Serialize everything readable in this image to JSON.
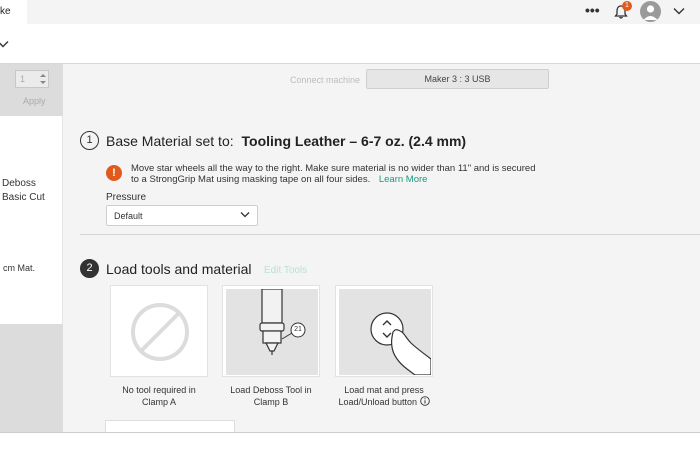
{
  "topbar": {
    "tab_label": "ke",
    "more_label": "•••",
    "notification_count": "1"
  },
  "sidebar": {
    "quantity_value": "1",
    "apply_label": "Apply",
    "items": [
      {
        "label": "Deboss"
      },
      {
        "label": "Basic Cut"
      },
      {
        "label": "cm Mat."
      }
    ]
  },
  "machine": {
    "connect_label": "Connect machine",
    "selected_machine": "Maker 3 : 3 USB"
  },
  "step1": {
    "number": "1",
    "title_prefix": "Base Material set to:",
    "material": "Tooling Leather – 6-7 oz. (2.4 mm)",
    "warning_icon": "!",
    "warning_text": "Move star wheels all the way to the right. Make sure material is no wider than 11\" and is secured to a StrongGrip Mat using masking tape on all four sides.",
    "learn_more_label": "Learn More",
    "pressure_label": "Pressure",
    "pressure_value": "Default"
  },
  "step2": {
    "number": "2",
    "title": "Load tools and material",
    "edit_tools_label": "Edit Tools",
    "cards": [
      {
        "label": "No tool required in Clamp A",
        "icon": "no-tool-icon"
      },
      {
        "label": "Load Deboss Tool in Clamp B",
        "icon": "deboss-tool-icon",
        "tool_number": "21"
      },
      {
        "label": "Load mat and press Load/Unload button",
        "icon": "load-mat-icon",
        "info_icon": "info-icon"
      }
    ]
  },
  "colors": {
    "accent_orange": "#e05a1e",
    "learn_more_green": "#1a9a7e",
    "edit_tools_green": "#b9e2d6",
    "main_bg": "#f4f4f4"
  }
}
